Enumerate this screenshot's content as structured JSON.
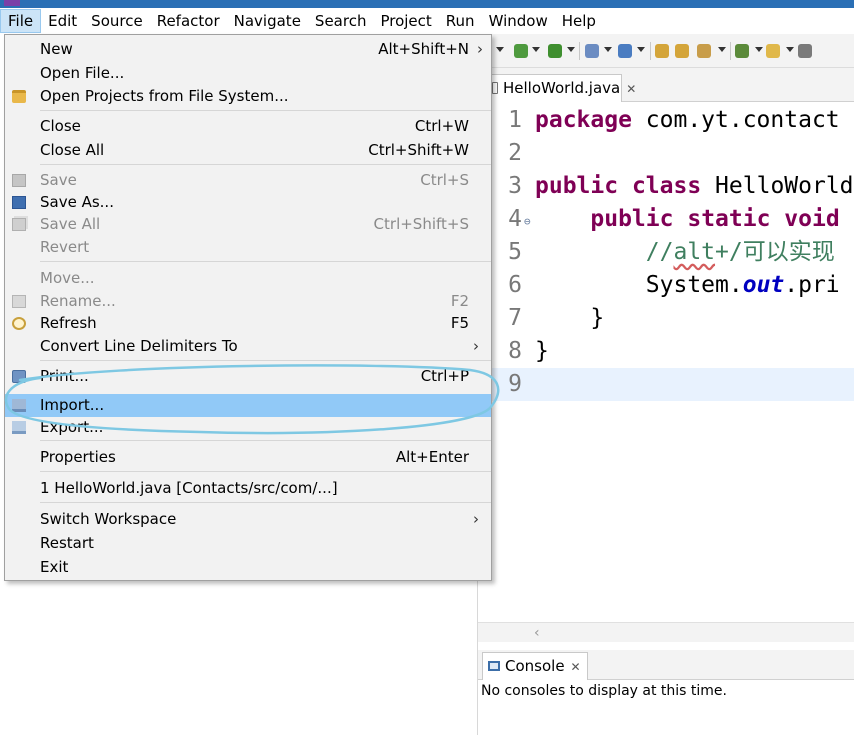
{
  "menubar": {
    "items": [
      "File",
      "Edit",
      "Source",
      "Refactor",
      "Navigate",
      "Search",
      "Project",
      "Run",
      "Window",
      "Help"
    ]
  },
  "file_menu": {
    "items": [
      {
        "label": "New",
        "shortcut": "Alt+Shift+N",
        "submenu": "›",
        "icon": "",
        "disabled": false
      },
      {
        "label": "Open File...",
        "shortcut": "",
        "icon": "",
        "disabled": false
      },
      {
        "label": "Open Projects from File System...",
        "shortcut": "",
        "icon": "folder-icon",
        "disabled": false
      },
      {
        "label": "Close",
        "shortcut": "Ctrl+W",
        "icon": "",
        "disabled": false
      },
      {
        "label": "Close All",
        "shortcut": "Ctrl+Shift+W",
        "icon": "",
        "disabled": false
      },
      {
        "label": "Save",
        "shortcut": "Ctrl+S",
        "icon": "save-icon",
        "disabled": true
      },
      {
        "label": "Save As...",
        "shortcut": "",
        "icon": "save-as-icon",
        "disabled": false
      },
      {
        "label": "Save All",
        "shortcut": "Ctrl+Shift+S",
        "icon": "save-all-icon",
        "disabled": true
      },
      {
        "label": "Revert",
        "shortcut": "",
        "icon": "",
        "disabled": true
      },
      {
        "label": "Move...",
        "shortcut": "",
        "icon": "",
        "disabled": true
      },
      {
        "label": "Rename...",
        "shortcut": "F2",
        "icon": "rename-icon",
        "disabled": true
      },
      {
        "label": "Refresh",
        "shortcut": "F5",
        "icon": "refresh-icon",
        "disabled": false
      },
      {
        "label": "Convert Line Delimiters To",
        "shortcut": "",
        "submenu": "›",
        "icon": "",
        "disabled": false
      },
      {
        "label": "Print...",
        "shortcut": "Ctrl+P",
        "icon": "print-icon",
        "disabled": false
      },
      {
        "label": "Import...",
        "shortcut": "",
        "icon": "import-icon",
        "disabled": false,
        "highlighted": true
      },
      {
        "label": "Export...",
        "shortcut": "",
        "icon": "export-icon",
        "disabled": false
      },
      {
        "label": "Properties",
        "shortcut": "Alt+Enter",
        "icon": "",
        "disabled": false
      },
      {
        "label": "1 HelloWorld.java  [Contacts/src/com/...]",
        "shortcut": "",
        "icon": "",
        "disabled": false
      },
      {
        "label": "Switch Workspace",
        "shortcut": "",
        "submenu": "›",
        "icon": "",
        "disabled": false
      },
      {
        "label": "Restart",
        "shortcut": "",
        "icon": "",
        "disabled": false
      },
      {
        "label": "Exit",
        "shortcut": "",
        "icon": "",
        "disabled": false
      }
    ]
  },
  "editor": {
    "tab_label": "HelloWorld.java",
    "tab_close": "✕",
    "lines": [
      {
        "n": "1",
        "parts": [
          [
            "kw",
            "package"
          ],
          [
            "",
            " com.yt.contact"
          ]
        ]
      },
      {
        "n": "2",
        "parts": []
      },
      {
        "n": "3",
        "parts": [
          [
            "kw",
            "public"
          ],
          [
            "",
            " "
          ],
          [
            "kw",
            "class"
          ],
          [
            "",
            " HelloWorld"
          ]
        ]
      },
      {
        "n": "4",
        "parts": [
          [
            "",
            "    "
          ],
          [
            "kw",
            "public"
          ],
          [
            "",
            " "
          ],
          [
            "kw",
            "static"
          ],
          [
            "",
            " "
          ],
          [
            "kw",
            "void"
          ]
        ],
        "fold": "⊖"
      },
      {
        "n": "5",
        "parts": [
          [
            "",
            "        "
          ],
          [
            "cm",
            "//"
          ],
          [
            "cm cm-u",
            "alt"
          ],
          [
            "cm",
            "+/可以实现"
          ]
        ]
      },
      {
        "n": "6",
        "parts": [
          [
            "",
            "        System."
          ],
          [
            "fld",
            "out"
          ],
          [
            "",
            ".pri"
          ]
        ]
      },
      {
        "n": "7",
        "parts": [
          [
            "",
            "    }"
          ]
        ]
      },
      {
        "n": "8",
        "parts": [
          [
            "",
            "}"
          ]
        ]
      },
      {
        "n": "9",
        "parts": [],
        "current": true
      }
    ]
  },
  "console": {
    "tab_label": "Console",
    "tab_close": "✕",
    "message": "No consoles to display at this time."
  },
  "colors": {
    "menu_highlight": "#91c9f7",
    "annotation_circle": "#7ec8e3",
    "keyword": "#7f0055",
    "comment": "#3f7f5f",
    "field": "#0000c0"
  }
}
